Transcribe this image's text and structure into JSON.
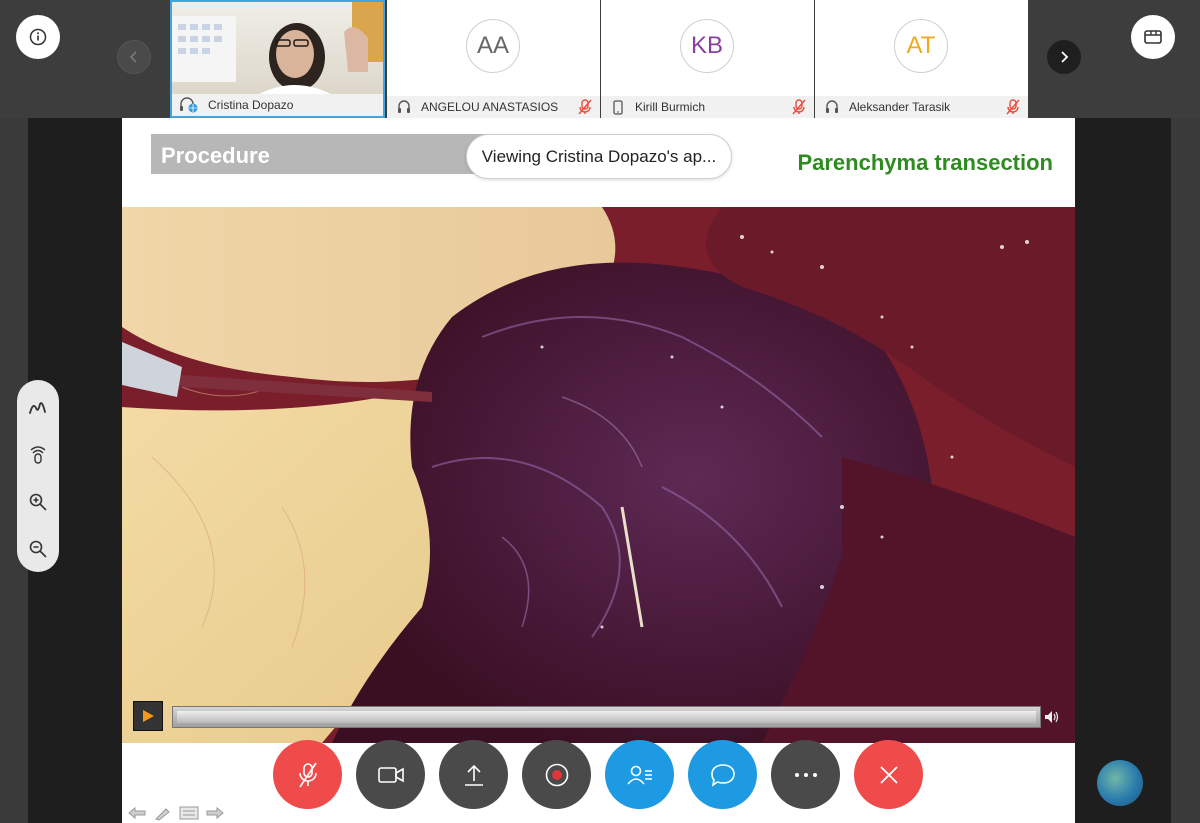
{
  "participants": [
    {
      "name": "Cristina Dopazo",
      "initials": "",
      "status_icon": "headset-globe-icon",
      "muted": false,
      "has_video": true
    },
    {
      "name": "ANGELOU ANASTASIOS",
      "initials": "AA",
      "initials_color": "#666666",
      "status_icon": "headset-icon",
      "muted": true
    },
    {
      "name": "Kirill Burmich",
      "initials": "KB",
      "initials_color": "#8a3fa0",
      "status_icon": "phone-icon",
      "muted": true
    },
    {
      "name": "Aleksander Tarasik",
      "initials": "AT",
      "initials_color": "#f0a820",
      "status_icon": "headset-icon",
      "muted": true
    }
  ],
  "slide": {
    "section_label": "Procedure",
    "phase_label": "Parenchyma transection"
  },
  "sharing_notice": "Viewing Cristina Dopazo's ap...",
  "colors": {
    "accent_blue": "#1e9ae2",
    "end_red": "#ef4b4b",
    "mute_red": "#e74c3c",
    "phase_green": "#2e8b20"
  },
  "left_tools": [
    "pen-icon",
    "pointer-icon",
    "zoom-in-icon",
    "zoom-out-icon"
  ],
  "controls": [
    "mute-mic-icon",
    "camera-icon",
    "share-icon",
    "record-icon",
    "participants-icon",
    "chat-icon",
    "more-icon",
    "end-call-icon"
  ]
}
